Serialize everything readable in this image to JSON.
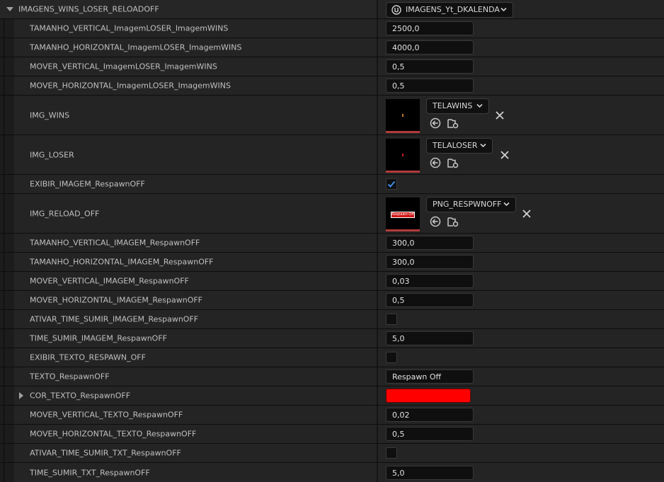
{
  "header": {
    "category": "IMAGENS_WINS_LOSER_RELOADOFF",
    "asset_label": "IMAGENS_Yt_DKALENDA",
    "asset_icon": "unreal-logo-icon"
  },
  "rows": [
    {
      "label": "TAMANHO_VERTICAL_ImagemLOSER_ImagemWINS",
      "value": "2500,0"
    },
    {
      "label": "TAMANHO_HORIZONTAL_ImagemLOSER_ImagemWINS",
      "value": "4000,0"
    },
    {
      "label": "MOVER_VERTICAL_ImagemLOSER_ImagemWINS",
      "value": "0,5"
    },
    {
      "label": "MOVER_HORIZONTAL_ImagemLOSER_ImagemWINS",
      "value": "0,5"
    },
    {
      "label": "IMG_WINS",
      "asset": "TELAWINS"
    },
    {
      "label": "IMG_LOSER",
      "asset": "TELALOSER"
    },
    {
      "label": "EXIBIR_IMAGEM_RespawnOFF",
      "checked": true
    },
    {
      "label": "IMG_RELOAD_OFF",
      "asset": "PNG_RESPWNOFF",
      "badge": "Respawn Off"
    },
    {
      "label": "TAMANHO_VERTICAL_IMAGEM_RespawnOFF",
      "value": "300,0"
    },
    {
      "label": "TAMANHO_HORIZONTAL_IMAGEM_RespawnOFF",
      "value": "300,0"
    },
    {
      "label": "MOVER_VERTICAL_IMAGEM_RespawnOFF",
      "value": "0,03"
    },
    {
      "label": "MOVER_HORIZONTAL_IMAGEM_RespawnOFF",
      "value": "0,5"
    },
    {
      "label": "ATIVAR_TIME_SUMIR_IMAGEM_RespawnOFF",
      "checked": false
    },
    {
      "label": "TIME_SUMIR_IMAGEM_RespawnOFF",
      "value": "5,0"
    },
    {
      "label": "EXIBIR_TEXTO_RESPAWN_OFF",
      "checked": false
    },
    {
      "label": "TEXTO_RespawnOFF",
      "value": "Respawn Off"
    },
    {
      "label": "COR_TEXTO_RespawnOFF",
      "color": "#ff0000"
    },
    {
      "label": "MOVER_VERTICAL_TEXTO_RespawnOFF",
      "value": "0,02"
    },
    {
      "label": "MOVER_HORIZONTAL_TEXTO_RespawnOFF",
      "value": "0,5"
    },
    {
      "label": "ATIVAR_TIME_SUMIR_TXT_RespawnOFF",
      "checked": false
    },
    {
      "label": "TIME_SUMIR_TXT_RespawnOFF",
      "value": "5,0"
    }
  ],
  "colors": {
    "accent_check": "#3d8ee6",
    "thumb_underline": "#b23a3a",
    "color_swatch": "#ff0000"
  }
}
